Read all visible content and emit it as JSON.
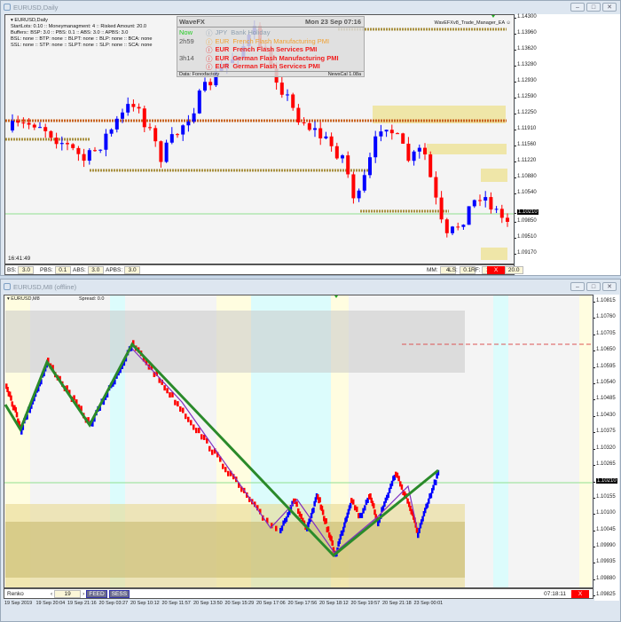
{
  "top_window": {
    "title": "EURUSD,Daily",
    "symbol_label": "EURUSD,Daily",
    "info_lines": [
      "StartLots: 0.10 :: Moneymanagment: 4 :: Risked Amount: 20.0",
      "Buffers:: BSP: 3.0 :: PBS: 0.1 :: ABS: 3.0 :: APBS: 3.0",
      "BSL: none :: BTP: none :: BLPT: none :: BLP: none :: BCA: none",
      "SSL: none :: STP: none :: SLPT: none :: SLP: none :: SCA: none"
    ],
    "ea_label": "WavEFXv8_Trade_Manager_EA",
    "clock": "16:41:49",
    "price_ticks": [
      "1.14300",
      "1.13960",
      "1.13620",
      "1.13280",
      "1.12930",
      "1.12590",
      "1.12250",
      "1.11910",
      "1.11560",
      "1.11220",
      "1.10880",
      "1.10540",
      "1.09850",
      "1.09510",
      "1.09170"
    ],
    "current_price": "1.10210",
    "toolbar": {
      "left": [
        {
          "label": "BS:",
          "value": "3.0"
        },
        {
          "label": "PBS:",
          "value": "0.1"
        },
        {
          "label": "ABS:",
          "value": "3.0"
        },
        {
          "label": "APBS:",
          "value": "3.0"
        }
      ],
      "right": [
        {
          "label": "MM:",
          "value": "4"
        },
        {
          "label": "LS:",
          "value": "0.1"
        },
        {
          "label": "RF:",
          "value": "1.0"
        },
        {
          "label": "RA:",
          "value": "20.0"
        }
      ],
      "close_label": "X"
    }
  },
  "news": {
    "title": "WaveFX",
    "datetime": "Mon 23 Sep 07:16",
    "items": [
      {
        "time": "Now",
        "currency": "JPY",
        "event": "Bank Holiday",
        "color": "#8fa0b0"
      },
      {
        "time": "2h59",
        "currency": "EUR",
        "event": "French Flash Manufacturing PMI",
        "color": "#f0a030"
      },
      {
        "time": "",
        "currency": "EUR",
        "event": "French Flash Services PMI",
        "color": "#f02020"
      },
      {
        "time": "3h14",
        "currency": "EUR",
        "event": "German Flash Manufacturing PMI",
        "color": "#f02020"
      },
      {
        "time": "",
        "currency": "EUR",
        "event": "German Flash Services PMI",
        "color": "#f02020"
      }
    ],
    "footer_left": "Data: Forexfactory",
    "footer_right": "NewsCal 1.08a"
  },
  "bottom_window": {
    "title": "EURUSD,M8 (offline)",
    "symbol_label": "EURUSD,M8",
    "spread": "Spread: 0.0",
    "price_ticks": [
      "1.10815",
      "1.10760",
      "1.10705",
      "1.10650",
      "1.10595",
      "1.10540",
      "1.10485",
      "1.10430",
      "1.10375",
      "1.10320",
      "1.10265",
      "1.10155",
      "1.10100",
      "1.10045",
      "1.09990",
      "1.09935",
      "1.09880",
      "1.09825"
    ],
    "current_price": "1.10210",
    "toolbar": {
      "mode": "Renko",
      "brick_value": "19",
      "feed": "FEED",
      "sess": "SESS",
      "timer": "07:18:11",
      "close_label": "X"
    },
    "time_ticks": [
      "19 Sep 2019",
      "19 Sep 20:04",
      "19 Sep 21:16",
      "20 Sep 03:27",
      "20 Sep 10:12",
      "20 Sep 11:57",
      "20 Sep 13:50",
      "20 Sep 15:29",
      "20 Sep 17:06",
      "20 Sep 17:56",
      "20 Sep 18:12",
      "20 Sep 19:57",
      "20 Sep 21:18",
      "23 Sep 00:01"
    ]
  },
  "colors": {
    "bull": "#0000ff",
    "bear": "#ff0000",
    "zigzag": "#2a8a2a",
    "current_line": "#90e090",
    "zone_yellow": "#efe6a8",
    "zone_tan": "#c8bb70"
  }
}
